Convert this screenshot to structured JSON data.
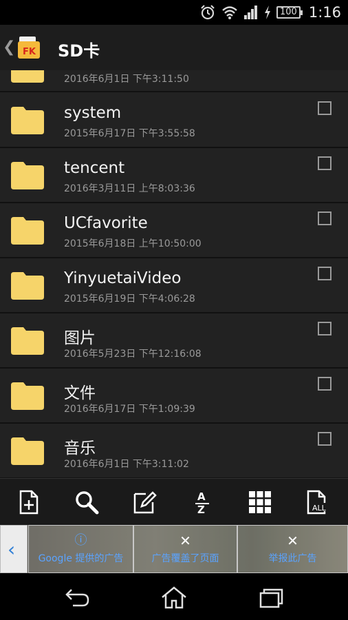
{
  "status_bar": {
    "battery": "100",
    "time": "1:16",
    "icons": [
      "alarm-icon",
      "wifi-icon",
      "signal-icon",
      "charging-icon",
      "battery-icon"
    ]
  },
  "action_bar": {
    "title": "SD卡",
    "logo_text": "FK"
  },
  "partial_row": {
    "date": "2016年6月1日 下午3:11:50"
  },
  "files": [
    {
      "name": "system",
      "date": "2015年6月17日 下午3:55:58"
    },
    {
      "name": "tencent",
      "date": "2016年3月11日 上午8:03:36"
    },
    {
      "name": "UCfavorite",
      "date": "2015年6月18日 上午10:50:00"
    },
    {
      "name": "YinyuetaiVideo",
      "date": "2015年6月19日 下午4:06:28"
    },
    {
      "name": "图片",
      "date": "2016年5月23日 下午12:16:08"
    },
    {
      "name": "文件",
      "date": "2016年6月17日 下午1:09:39"
    },
    {
      "name": "音乐",
      "date": "2016年6月1日 下午3:11:02"
    }
  ],
  "toolbar": {
    "items": [
      "new-file-icon",
      "search-icon",
      "edit-icon",
      "sort-az-icon",
      "grid-view-icon",
      "select-all-icon"
    ],
    "sort_top": "A",
    "sort_bottom": "Z",
    "all_label": "ALL"
  },
  "ad_bar": {
    "google_label": "Google 提供的广告",
    "covers_label": "广告覆盖了页面",
    "report_label": "举报此广告"
  },
  "colors": {
    "folder": "#f6d46a",
    "accent_blue": "#5aa3ff",
    "list_bg": "#222222"
  }
}
